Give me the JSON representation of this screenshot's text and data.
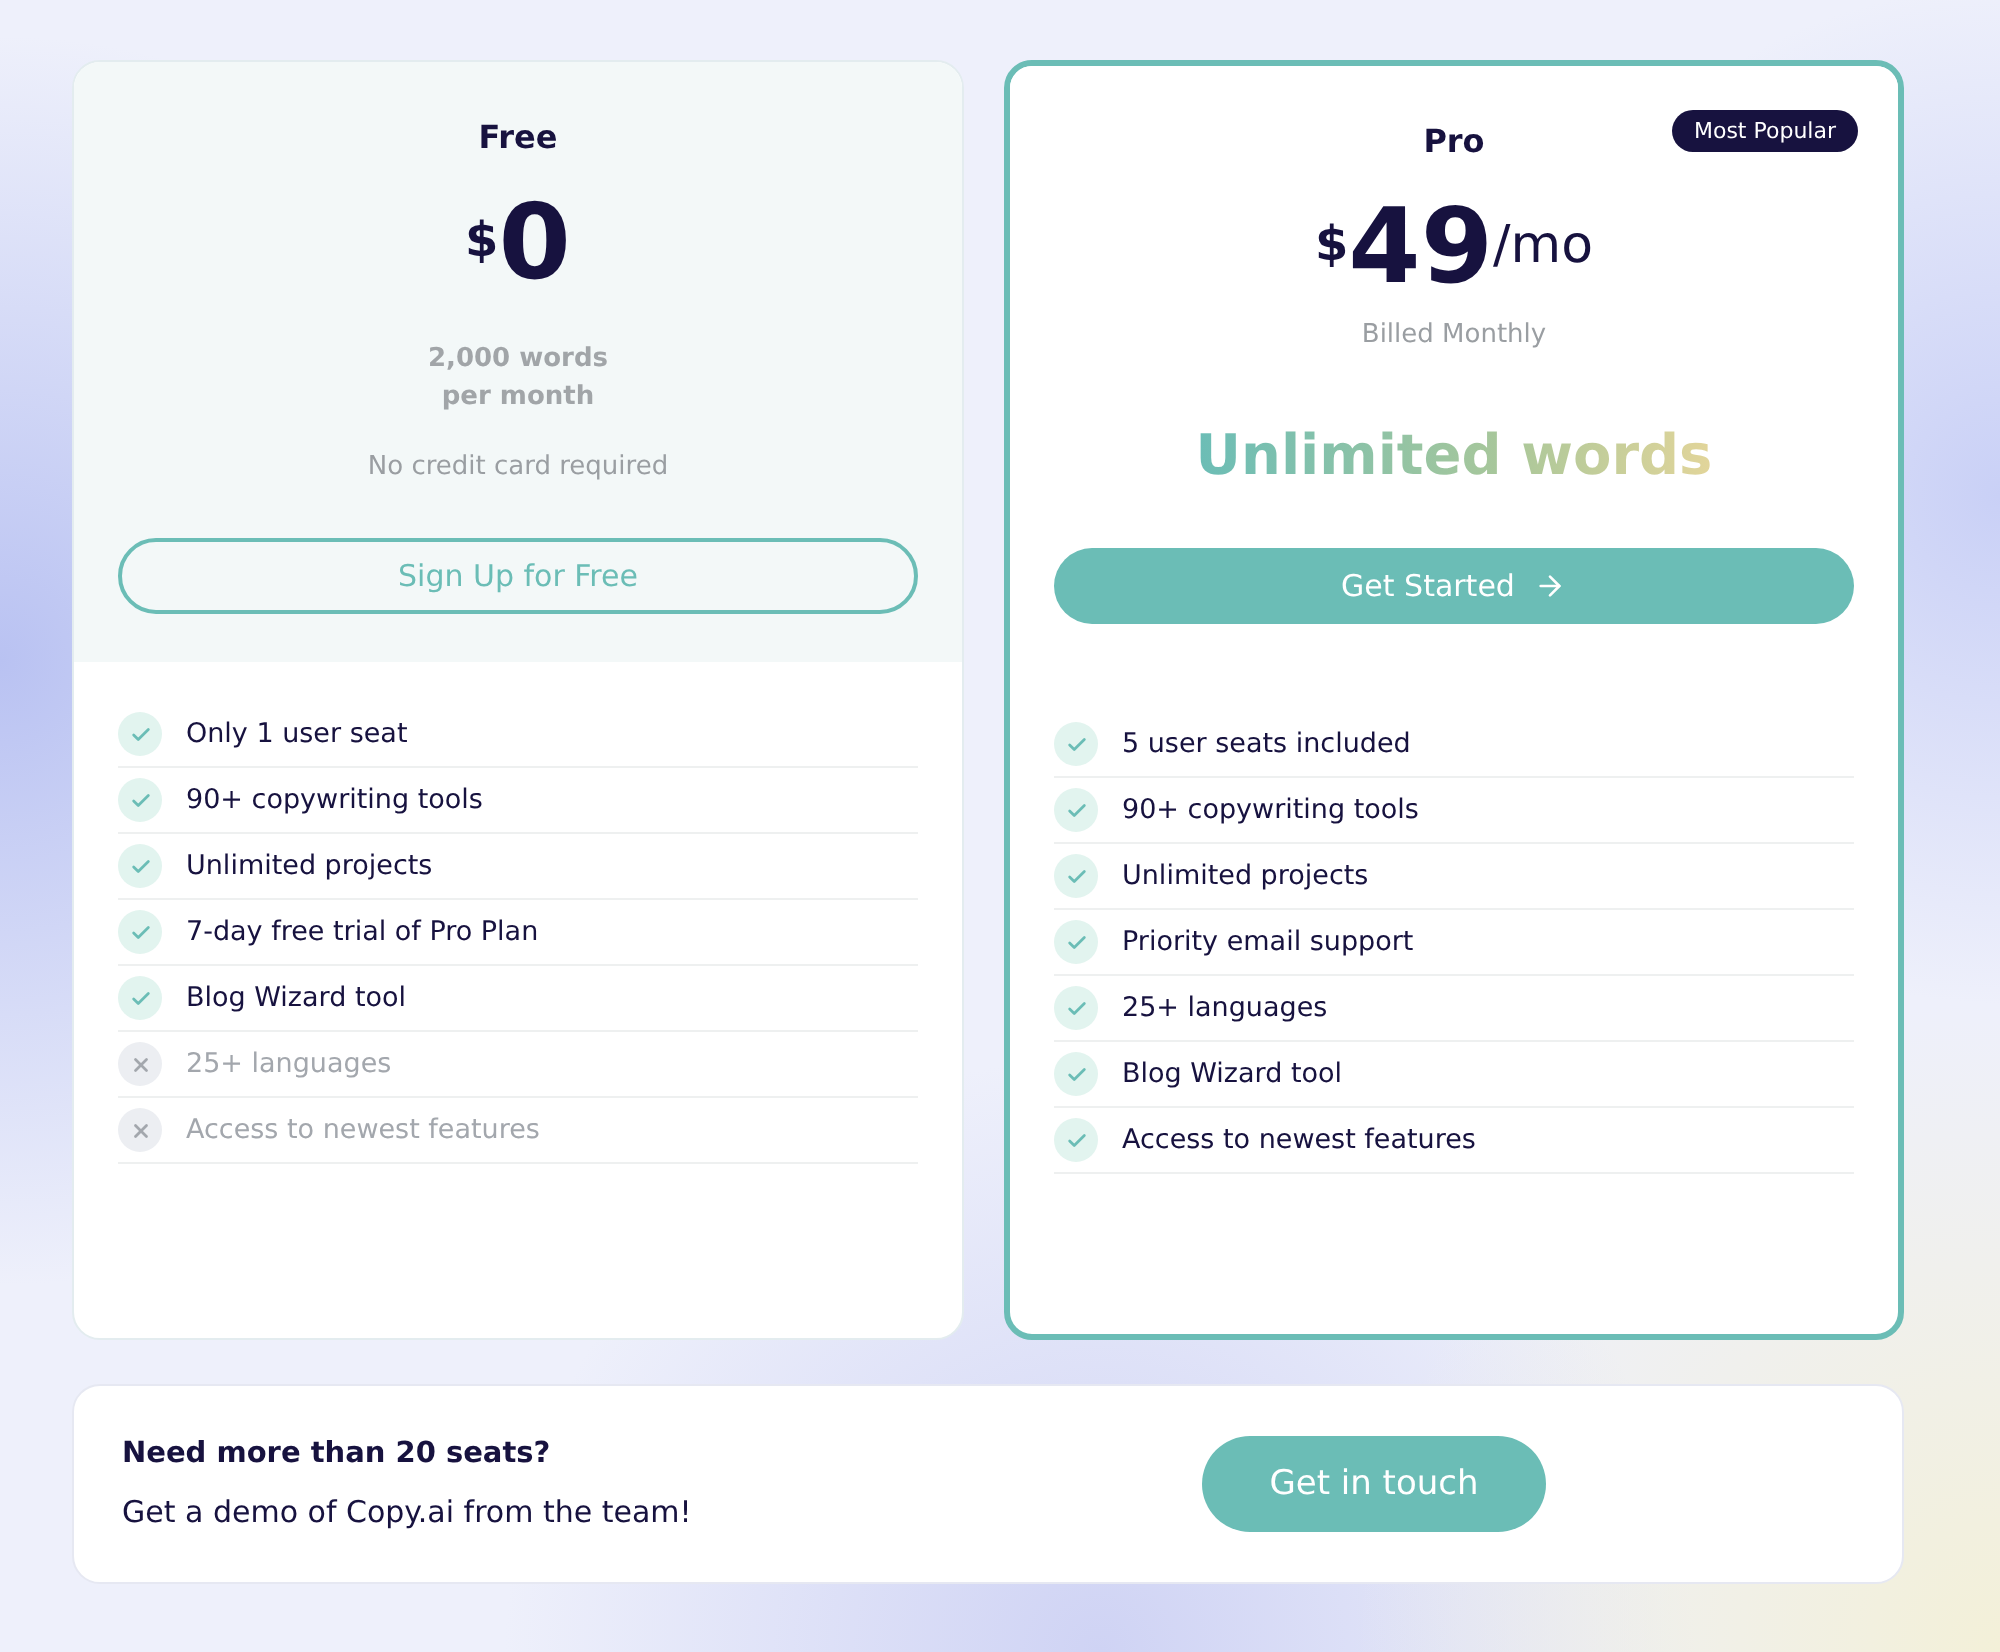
{
  "plans": [
    {
      "name": "Free",
      "featured": false,
      "currency": "$",
      "amount": "0",
      "subtitle": "2,000 words per month",
      "note": "No credit card required",
      "button": {
        "label": "Sign Up for Free",
        "kind": "outline",
        "arrow": false
      },
      "features": [
        {
          "label": "Only 1 user seat",
          "included": true
        },
        {
          "label": "90+ copywriting tools",
          "included": true
        },
        {
          "label": "Unlimited projects",
          "included": true
        },
        {
          "label": "7-day free trial of Pro Plan",
          "included": true
        },
        {
          "label": "Blog Wizard tool",
          "included": true
        },
        {
          "label": "25+ languages",
          "included": false
        },
        {
          "label": "Access to newest features",
          "included": false
        }
      ]
    },
    {
      "name": "Pro",
      "featured": true,
      "badge": "Most Popular",
      "currency": "$",
      "amount": "49",
      "period": "/mo",
      "billing": "Billed Monthly",
      "highlight": "Unlimited words",
      "button": {
        "label": "Get Started",
        "kind": "filled",
        "arrow": true
      },
      "features": [
        {
          "label": "5 user seats included",
          "included": true
        },
        {
          "label": "90+ copywriting tools",
          "included": true
        },
        {
          "label": "Unlimited projects",
          "included": true
        },
        {
          "label": "Priority email support",
          "included": true
        },
        {
          "label": "25+ languages",
          "included": true
        },
        {
          "label": "Blog Wizard tool",
          "included": true
        },
        {
          "label": "Access to newest features",
          "included": true
        }
      ]
    }
  ],
  "contact": {
    "title": "Need more than 20 seats?",
    "text": "Get a demo of Copy.ai from the team!",
    "button": "Get in touch"
  }
}
